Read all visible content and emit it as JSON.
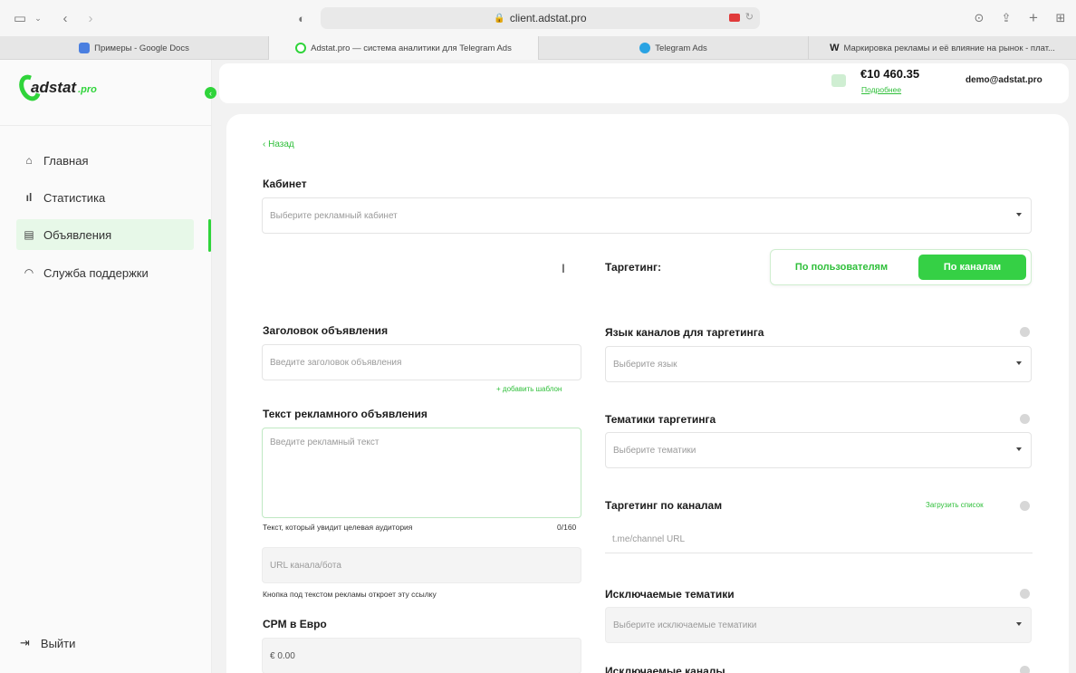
{
  "browser": {
    "url": "client.adstat.pro",
    "tabs": [
      {
        "label": "Примеры - Google Docs",
        "favicon_color": "#4a7fe0"
      },
      {
        "label": "Adstat.pro — система аналитики для Telegram Ads",
        "favicon_color": "#2fd43a"
      },
      {
        "label": "Telegram Ads",
        "favicon_color": "#2aa3e3"
      },
      {
        "label": "Маркировка рекламы и её влияние на рынок - плат...",
        "favicon_color": "#444444"
      }
    ],
    "wiki_mark": "W"
  },
  "sidebar": {
    "logo_text": "adstat",
    "logo_suffix": ".pro",
    "items": [
      {
        "label": "Главная",
        "icon": "home-icon"
      },
      {
        "label": "Статистика",
        "icon": "bar-chart-icon"
      },
      {
        "label": "Объявления",
        "icon": "document-icon"
      },
      {
        "label": "Служба поддержки",
        "icon": "headset-icon"
      }
    ],
    "logout": "Выйти"
  },
  "header": {
    "balance": "€10 460.35",
    "balance_link": "Подробнее",
    "email": "demo@adstat.pro"
  },
  "form": {
    "back": "‹ Назад",
    "cabinet_label": "Кабинет",
    "cabinet_placeholder": "Выберите рекламный кабинет",
    "targeting_label": "Таргетинг:",
    "targeting_by_users": "По пользователям",
    "targeting_by_channels": "По каналам",
    "title_label": "Заголовок объявления",
    "title_placeholder": "Введите заголовок объявления",
    "add_template": "+ добавить шаблон",
    "text_label": "Текст рекламного объявления",
    "text_placeholder": "Введите рекламный текст",
    "text_hint": "Текст, который увидит целевая аудитория",
    "text_counter": "0/160",
    "url_placeholder": "URL канала/бота",
    "url_hint": "Кнопка под текстом рекламы откроет эту ссылку",
    "cpm_label": "CPM в Евро",
    "cpm_value": "€ 0.00",
    "lang_label": "Язык каналов для таргетинга",
    "lang_placeholder": "Выберите язык",
    "topics_label": "Тематики таргетинга",
    "topics_placeholder": "Выберите тематики",
    "channels_label": "Таргетинг по каналам",
    "upload_list": "Загрузить список",
    "channels_placeholder": "t.me/channel URL",
    "excluded_topics_label": "Исключаемые тематики",
    "excluded_topics_placeholder": "Выберите исключаемые тематики",
    "excluded_channels_label": "Исключаемые каналы"
  }
}
